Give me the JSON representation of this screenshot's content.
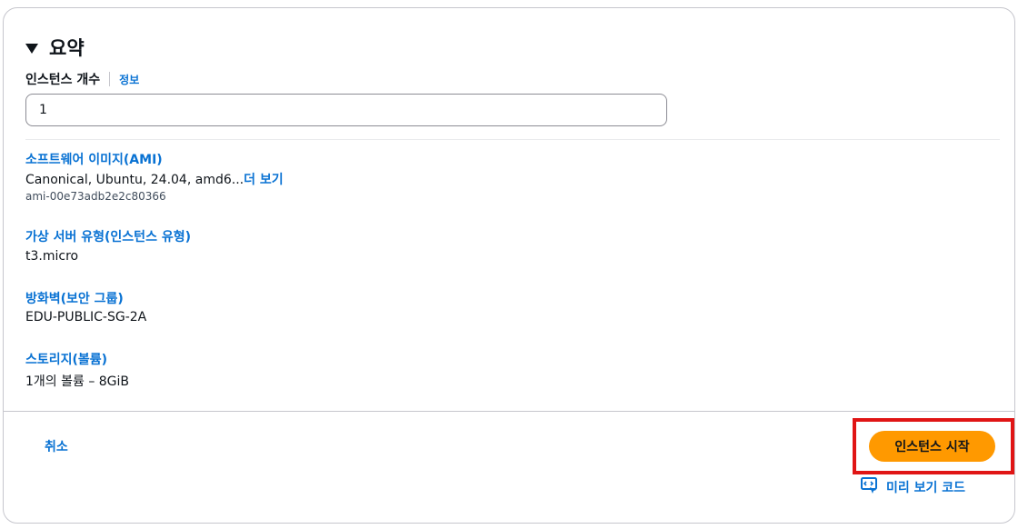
{
  "summary": {
    "title": "요약",
    "instance_count": {
      "label": "인스턴스 개수",
      "info": "정보",
      "value": "1"
    },
    "sections": [
      {
        "title": "소프트웨어 이미지(AMI)",
        "value": "Canonical, Ubuntu, 24.04, amd6...",
        "more": "더 보기",
        "sub": "ami-00e73adb2e2c80366"
      },
      {
        "title": "가상 서버 유형(인스턴스 유형)",
        "value": "t3.micro"
      },
      {
        "title": "방화벽(보안 그룹)",
        "value": "EDU-PUBLIC-SG-2A"
      },
      {
        "title": "스토리지(볼륨)",
        "value": "1개의 볼륨 – 8GiB"
      }
    ]
  },
  "footer": {
    "cancel_label": "취소",
    "launch_label": "인스턴스 시작",
    "preview_label": "미리 보기 코드"
  },
  "colors": {
    "link": "#0972d3",
    "primary_button": "#ff9900",
    "highlight_box": "#e01515"
  },
  "icons": {
    "collapse": "caret-down-icon",
    "preview": "code-preview-icon"
  }
}
